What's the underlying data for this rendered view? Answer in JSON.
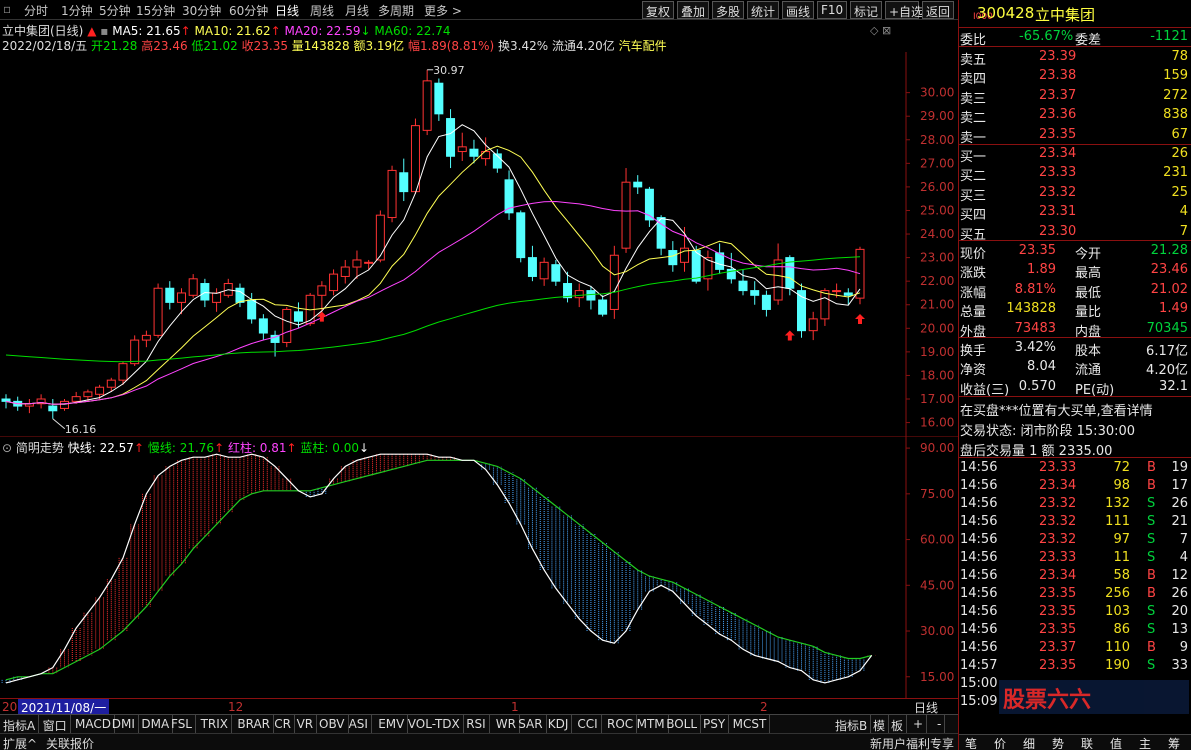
{
  "toolbar": {
    "periods": [
      "分时",
      "1分钟",
      "5分钟",
      "15分钟",
      "30分钟",
      "60分钟",
      "日线",
      "周线",
      "月线",
      "多周期",
      "更多 >"
    ],
    "active_period": "日线",
    "buttons": [
      "复权",
      "叠加",
      "多股",
      "统计",
      "画线",
      "F10",
      "标记",
      "+自选",
      "返回"
    ]
  },
  "chart_header": {
    "title": "立中集团(日线)",
    "ma5": "MA5: 21.65",
    "ma10": "MA10: 21.62",
    "ma20": "MA20: 22.59",
    "ma60": "MA60: 22.74",
    "date": "2022/02/18/五",
    "open": "开21.28",
    "high": "高23.46",
    "low": "低21.02",
    "close": "收23.35",
    "volume": "量143828",
    "amount": "额3.19亿",
    "change": "幅1.89(8.81%)",
    "turnover": "换3.42%",
    "float": "流通4.20亿",
    "sector": "汽车配件"
  },
  "chart_data": [
    {
      "type": "candlestick",
      "title": "立中集团(日线)",
      "y_ticks": [
        "30.00",
        "29.00",
        "28.00",
        "27.00",
        "26.00",
        "25.00",
        "24.00",
        "23.00",
        "22.00",
        "21.00",
        "20.00",
        "19.00",
        "18.00",
        "17.00",
        "16.00"
      ],
      "ylim": [
        15.6,
        31.3
      ],
      "annotations": {
        "high": "30.97",
        "low": "16.16"
      },
      "ohlc": [
        [
          17.0,
          17.2,
          16.6,
          16.9
        ],
        [
          16.9,
          17.1,
          16.5,
          16.7
        ],
        [
          16.7,
          17.0,
          16.4,
          16.8
        ],
        [
          16.8,
          17.2,
          16.6,
          17.0
        ],
        [
          16.7,
          17.0,
          16.16,
          16.5
        ],
        [
          16.6,
          17.0,
          16.5,
          16.9
        ],
        [
          16.9,
          17.3,
          16.8,
          17.1
        ],
        [
          17.1,
          17.4,
          16.9,
          17.3
        ],
        [
          17.2,
          17.6,
          17.0,
          17.5
        ],
        [
          17.5,
          17.9,
          17.3,
          17.8
        ],
        [
          17.8,
          18.6,
          17.6,
          18.5
        ],
        [
          18.5,
          19.7,
          18.4,
          19.5
        ],
        [
          19.5,
          19.9,
          19.2,
          19.7
        ],
        [
          19.7,
          21.9,
          19.6,
          21.7
        ],
        [
          21.7,
          22.0,
          20.8,
          21.1
        ],
        [
          21.1,
          21.7,
          20.6,
          21.5
        ],
        [
          21.4,
          22.3,
          21.3,
          22.1
        ],
        [
          21.9,
          22.1,
          20.9,
          21.2
        ],
        [
          21.1,
          21.7,
          20.7,
          21.5
        ],
        [
          21.4,
          22.1,
          21.3,
          21.9
        ],
        [
          21.7,
          21.9,
          20.9,
          21.1
        ],
        [
          21.2,
          21.5,
          20.2,
          20.4
        ],
        [
          20.4,
          20.6,
          19.5,
          19.8
        ],
        [
          19.7,
          19.9,
          18.8,
          19.4
        ],
        [
          19.4,
          20.9,
          19.2,
          20.8
        ],
        [
          20.7,
          21.1,
          20.0,
          20.3
        ],
        [
          20.2,
          21.5,
          20.1,
          21.4
        ],
        [
          21.4,
          22.0,
          20.7,
          21.8
        ],
        [
          21.6,
          22.5,
          21.4,
          22.3
        ],
        [
          22.2,
          22.9,
          21.9,
          22.6
        ],
        [
          22.6,
          23.3,
          22.1,
          22.9
        ],
        [
          22.8,
          22.9,
          22.5,
          22.8
        ],
        [
          22.9,
          25.0,
          22.8,
          24.8
        ],
        [
          24.7,
          26.9,
          24.5,
          26.7
        ],
        [
          26.6,
          27.2,
          25.4,
          25.8
        ],
        [
          25.8,
          28.9,
          25.7,
          28.6
        ],
        [
          28.4,
          30.97,
          28.2,
          30.5
        ],
        [
          30.4,
          30.6,
          28.8,
          29.1
        ],
        [
          28.9,
          29.3,
          26.8,
          27.3
        ],
        [
          27.5,
          28.3,
          27.1,
          27.7
        ],
        [
          27.6,
          28.0,
          27.0,
          27.3
        ],
        [
          27.2,
          28.1,
          26.9,
          27.5
        ],
        [
          27.4,
          27.6,
          26.6,
          26.8
        ],
        [
          26.3,
          26.7,
          24.6,
          24.9
        ],
        [
          24.9,
          25.0,
          22.8,
          23.0
        ],
        [
          23.0,
          23.5,
          22.0,
          22.2
        ],
        [
          22.1,
          23.0,
          21.8,
          22.8
        ],
        [
          22.7,
          22.9,
          21.8,
          22.0
        ],
        [
          21.9,
          22.4,
          21.1,
          21.3
        ],
        [
          21.3,
          21.9,
          20.9,
          21.6
        ],
        [
          21.6,
          21.8,
          20.8,
          21.2
        ],
        [
          21.2,
          21.4,
          20.5,
          20.6
        ],
        [
          20.8,
          23.5,
          20.4,
          23.1
        ],
        [
          23.4,
          26.8,
          23.2,
          26.2
        ],
        [
          26.2,
          26.5,
          25.7,
          26.0
        ],
        [
          25.9,
          26.0,
          24.3,
          24.6
        ],
        [
          24.7,
          24.8,
          23.1,
          23.4
        ],
        [
          23.3,
          23.7,
          22.4,
          22.7
        ],
        [
          22.8,
          24.3,
          22.4,
          23.4
        ],
        [
          23.3,
          23.5,
          21.9,
          22.0
        ],
        [
          22.1,
          23.3,
          21.6,
          23.0
        ],
        [
          23.2,
          23.6,
          22.3,
          22.5
        ],
        [
          22.5,
          23.2,
          21.9,
          22.1
        ],
        [
          22.0,
          22.5,
          21.4,
          21.6
        ],
        [
          21.6,
          22.0,
          21.0,
          21.4
        ],
        [
          21.4,
          21.6,
          20.5,
          20.8
        ],
        [
          21.2,
          23.6,
          21.0,
          22.9
        ],
        [
          23.0,
          23.1,
          21.4,
          21.7
        ],
        [
          21.6,
          21.9,
          19.6,
          19.9
        ],
        [
          19.9,
          20.7,
          19.5,
          20.4
        ],
        [
          20.4,
          21.7,
          20.1,
          21.6
        ],
        [
          21.6,
          21.9,
          21.3,
          21.6
        ],
        [
          21.5,
          21.7,
          21.0,
          21.4
        ],
        [
          21.28,
          23.46,
          21.02,
          23.35
        ]
      ]
    },
    {
      "type": "line",
      "title": "简明走势",
      "series": [
        {
          "name": "快线",
          "label": "快线: 22.57"
        },
        {
          "name": "慢线",
          "label": "慢线: 21.76"
        },
        {
          "name": "红柱",
          "label": "红柱: 0.81"
        },
        {
          "name": "蓝柱",
          "label": "蓝柱: 0.00"
        }
      ],
      "y_ticks": [
        "90.00",
        "75.00",
        "60.00",
        "45.00",
        "30.00",
        "15.00"
      ],
      "ylim": [
        10,
        92
      ],
      "fast": [
        13,
        14,
        15,
        16,
        18,
        24,
        31,
        36,
        41,
        47,
        54,
        65,
        75,
        81,
        84,
        86,
        87,
        87,
        88,
        87,
        87,
        88,
        87,
        84,
        80,
        76,
        74,
        75,
        80,
        84,
        86,
        87,
        88,
        88,
        88,
        88,
        88,
        87,
        87,
        86,
        86,
        83,
        78,
        72,
        65,
        57,
        50,
        44,
        39,
        34,
        30,
        27,
        26,
        30,
        37,
        43,
        45,
        43,
        39,
        35,
        32,
        29,
        27,
        24,
        22,
        21,
        20,
        18,
        17,
        14,
        13,
        14,
        15,
        17,
        22
      ],
      "slow": [
        14,
        15,
        15,
        16,
        16,
        18,
        20,
        22,
        24,
        27,
        30,
        34,
        38,
        43,
        48,
        52,
        57,
        61,
        65,
        69,
        73,
        75,
        76,
        76,
        76,
        76,
        76,
        77,
        78,
        79,
        80,
        81,
        82,
        83,
        84,
        85,
        86,
        86,
        86,
        86,
        86,
        85,
        84,
        82,
        80,
        77,
        74,
        71,
        68,
        65,
        62,
        59,
        56,
        53,
        50,
        48,
        47,
        46,
        44,
        42,
        40,
        38,
        36,
        34,
        32,
        30,
        28,
        27,
        26,
        25,
        23,
        22,
        21,
        21,
        22
      ]
    }
  ],
  "axis": {
    "date_labels": [
      "2021/11/08/一",
      "12",
      "1",
      "2"
    ],
    "period_label": "日线",
    "left_marker": "20"
  },
  "bottom_tabs": [
    "指标A",
    "窗口",
    "MACD",
    "DMI",
    "DMA",
    "FSL",
    "TRIX",
    "BRAR",
    "CR",
    "VR",
    "OBV",
    "ASI",
    "EMV",
    "VOL-TDX",
    "RSI",
    "WR",
    "SAR",
    "KDJ",
    "CCI",
    "ROC",
    "MTM",
    "BOLL",
    "PSY",
    "MCST",
    "指标B",
    "模",
    "板",
    "+",
    "-"
  ],
  "status_bar": {
    "left": [
      "扩展^",
      "关联报价"
    ],
    "right": "新用户福利专享"
  },
  "right_panel": {
    "code": "300428",
    "name": "立中集团",
    "prefix": "I000",
    "webi_label": "委比",
    "webi": "-65.67%",
    "weicha_label": "委差",
    "weicha": "-1121",
    "asks": [
      {
        "label": "卖五",
        "price": "23.39",
        "vol": "78"
      },
      {
        "label": "卖四",
        "price": "23.38",
        "vol": "159"
      },
      {
        "label": "卖三",
        "price": "23.37",
        "vol": "272"
      },
      {
        "label": "卖二",
        "price": "23.36",
        "vol": "838"
      },
      {
        "label": "卖一",
        "price": "23.35",
        "vol": "67"
      }
    ],
    "bids": [
      {
        "label": "买一",
        "price": "23.34",
        "vol": "26"
      },
      {
        "label": "买二",
        "price": "23.33",
        "vol": "231"
      },
      {
        "label": "买三",
        "price": "23.32",
        "vol": "25"
      },
      {
        "label": "买四",
        "price": "23.31",
        "vol": "4"
      },
      {
        "label": "买五",
        "price": "23.30",
        "vol": "7"
      }
    ],
    "quote": [
      {
        "l1": "现价",
        "v1": "23.35",
        "l2": "今开",
        "v2": "21.28"
      },
      {
        "l1": "涨跌",
        "v1": "1.89",
        "l2": "最高",
        "v2": "23.46"
      },
      {
        "l1": "涨幅",
        "v1": "8.81%",
        "l2": "最低",
        "v2": "21.02"
      },
      {
        "l1": "总量",
        "v1": "143828",
        "l2": "量比",
        "v2": "1.49"
      },
      {
        "l1": "外盘",
        "v1": "73483",
        "l2": "内盘",
        "v2": "70345"
      }
    ],
    "stats": [
      {
        "l1": "换手",
        "v1": "3.42%",
        "l2": "股本",
        "v2": "6.17亿"
      },
      {
        "l1": "净资",
        "v1": "8.04",
        "l2": "流通",
        "v2": "4.20亿"
      },
      {
        "l1": "收益(三)",
        "v1": "0.570",
        "l2": "PE(动)",
        "v2": "32.1"
      }
    ],
    "notice": "在买盘***位置有大买单,查看详情",
    "trade_state": "交易状态: 闭市阶段 15:30:00",
    "after_hours": "盘后交易量 1 额 2335.00",
    "ticks": [
      {
        "t": "14:56",
        "p": "23.33",
        "v": "72",
        "d": "B",
        "n": "19"
      },
      {
        "t": "14:56",
        "p": "23.34",
        "v": "98",
        "d": "B",
        "n": "17"
      },
      {
        "t": "14:56",
        "p": "23.32",
        "v": "132",
        "d": "S",
        "n": "26"
      },
      {
        "t": "14:56",
        "p": "23.32",
        "v": "111",
        "d": "S",
        "n": "21"
      },
      {
        "t": "14:56",
        "p": "23.32",
        "v": "97",
        "d": "S",
        "n": "7"
      },
      {
        "t": "14:56",
        "p": "23.33",
        "v": "11",
        "d": "S",
        "n": "4"
      },
      {
        "t": "14:56",
        "p": "23.34",
        "v": "58",
        "d": "B",
        "n": "12"
      },
      {
        "t": "14:56",
        "p": "23.35",
        "v": "256",
        "d": "B",
        "n": "26"
      },
      {
        "t": "14:56",
        "p": "23.35",
        "v": "103",
        "d": "S",
        "n": "20"
      },
      {
        "t": "14:56",
        "p": "23.35",
        "v": "86",
        "d": "S",
        "n": "13"
      },
      {
        "t": "14:56",
        "p": "23.37",
        "v": "110",
        "d": "B",
        "n": "9"
      },
      {
        "t": "14:57",
        "p": "23.35",
        "v": "190",
        "d": "S",
        "n": "33"
      },
      {
        "t": "15:00",
        "p": "",
        "v": "",
        "d": "",
        "n": ""
      },
      {
        "t": "15:09",
        "p": "",
        "v": "",
        "d": "",
        "n": ""
      }
    ],
    "bottom_tabs": [
      "笔",
      "价",
      "细",
      "势",
      "联",
      "值",
      "主",
      "筹"
    ],
    "watermark": "股票六六"
  },
  "colors": {
    "up": "#ff3333",
    "down": "#54ffff",
    "ma5": "#ffffff",
    "ma10": "#ffff55",
    "ma20": "#ff44ff",
    "ma60": "#00dd00"
  }
}
